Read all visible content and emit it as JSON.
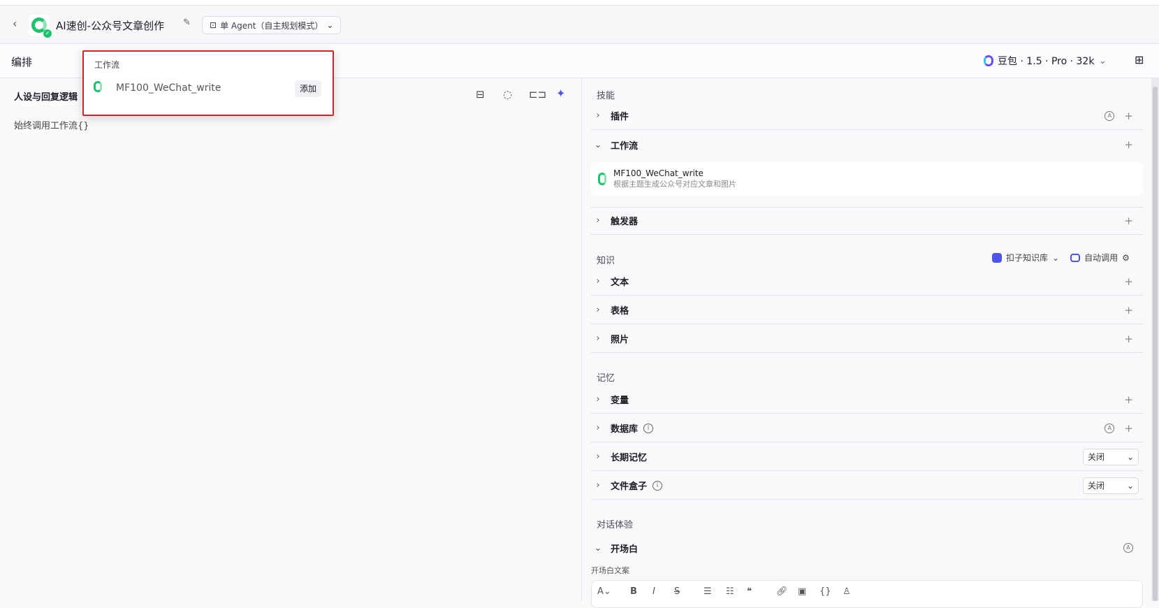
{
  "header": {
    "title": "AI速创-公众号文章创作",
    "mode": "单 Agent（自主规划模式）"
  },
  "subbar": {
    "title": "编排",
    "model": "豆包 · 1.5 · Pro · 32k"
  },
  "left": {
    "section_title": "人设与回复逻辑",
    "prompt": "始终调用工作流{}"
  },
  "popup": {
    "title": "工作流",
    "item": "MF100_WeChat_write",
    "add": "添加"
  },
  "skills": {
    "title": "技能",
    "plugin": "插件",
    "workflow": "工作流",
    "workflow_item": {
      "name": "MF100_WeChat_write",
      "desc": "根据主题生成公众号对应文章和图片"
    },
    "trigger": "触发器"
  },
  "knowledge": {
    "title": "知识",
    "source": "扣子知识库",
    "call_mode": "自动调用",
    "text": "文本",
    "table": "表格",
    "photo": "照片"
  },
  "memory": {
    "title": "记忆",
    "variable": "变量",
    "database": "数据库",
    "long_term": "长期记忆",
    "long_term_value": "关闭",
    "filebox": "文件盒子",
    "filebox_value": "关闭"
  },
  "dialog": {
    "title": "对话体验",
    "opening": "开场白",
    "opening_copy": "开场白文案"
  },
  "colors": {
    "accent": "#4d53e8",
    "highlight": "#e02020",
    "brand_green": "#1ec46b"
  }
}
